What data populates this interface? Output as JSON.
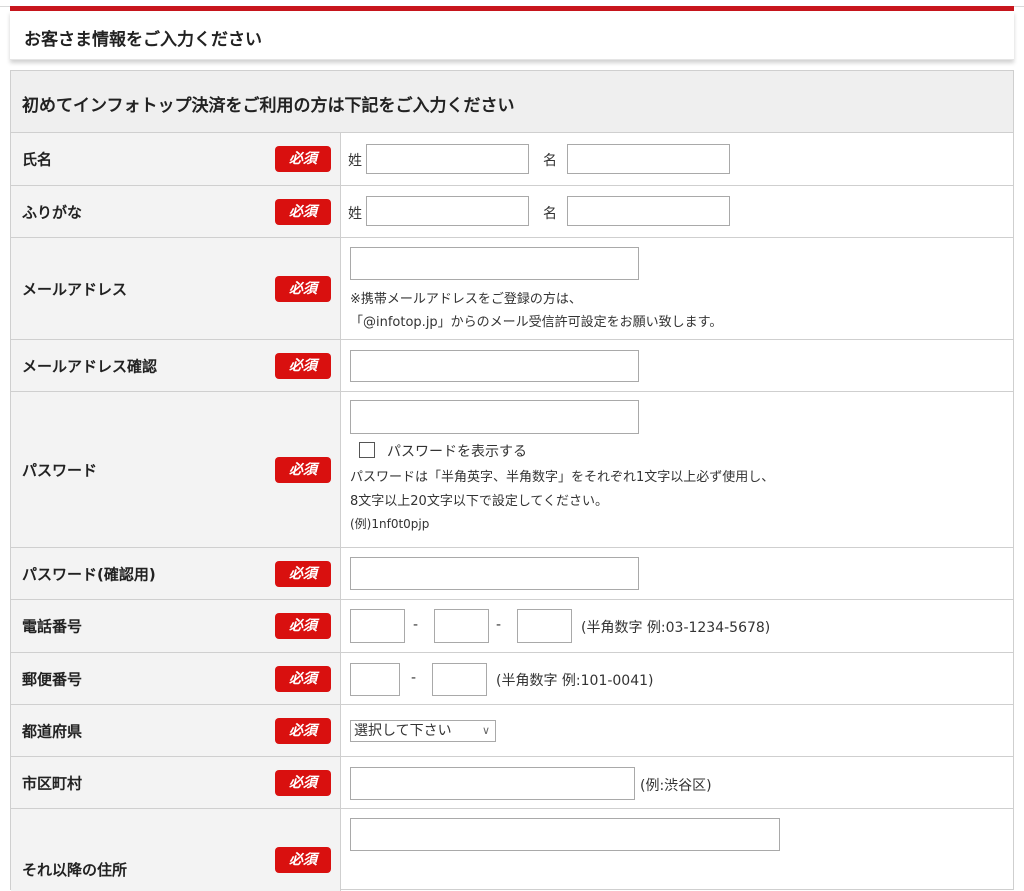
{
  "header": {
    "title": "お客さま情報をご入力ください"
  },
  "form": {
    "caption": "初めてインフォトップ決済をご利用の方は下記をご入力ください",
    "required_label": "必須",
    "name_row": {
      "label": "氏名",
      "sei": "姓",
      "mei": "名"
    },
    "kana_row": {
      "label": "ふりがな",
      "sei": "姓",
      "mei": "名"
    },
    "email_row": {
      "label": "メールアドレス",
      "note1": "※携帯メールアドレスをご登録の方は、",
      "note2": "「@infotop.jp」からのメール受信許可設定をお願い致します。"
    },
    "email_confirm_row": {
      "label": "メールアドレス確認"
    },
    "password_row": {
      "label": "パスワード",
      "show_password": "パスワードを表示する",
      "note1": "パスワードは「半角英字、半角数字」をそれぞれ1文字以上必ず使用し、",
      "note2": "8文字以上20文字以下で設定してください。",
      "note3": "(例)1nf0t0pjp"
    },
    "password_confirm_row": {
      "label": "パスワード(確認用)"
    },
    "phone_row": {
      "label": "電話番号",
      "dash": "-",
      "hint": "(半角数字 例:03-1234-5678)"
    },
    "postal_row": {
      "label": "郵便番号",
      "dash": "-",
      "hint": "(半角数字 例:101-0041)"
    },
    "prefecture_row": {
      "label": "都道府県",
      "select_value": "選択して下さい"
    },
    "city_row": {
      "label": "市区町村",
      "hint": "(例:渋谷区)"
    },
    "address_row": {
      "label": "それ以降の住所"
    }
  }
}
